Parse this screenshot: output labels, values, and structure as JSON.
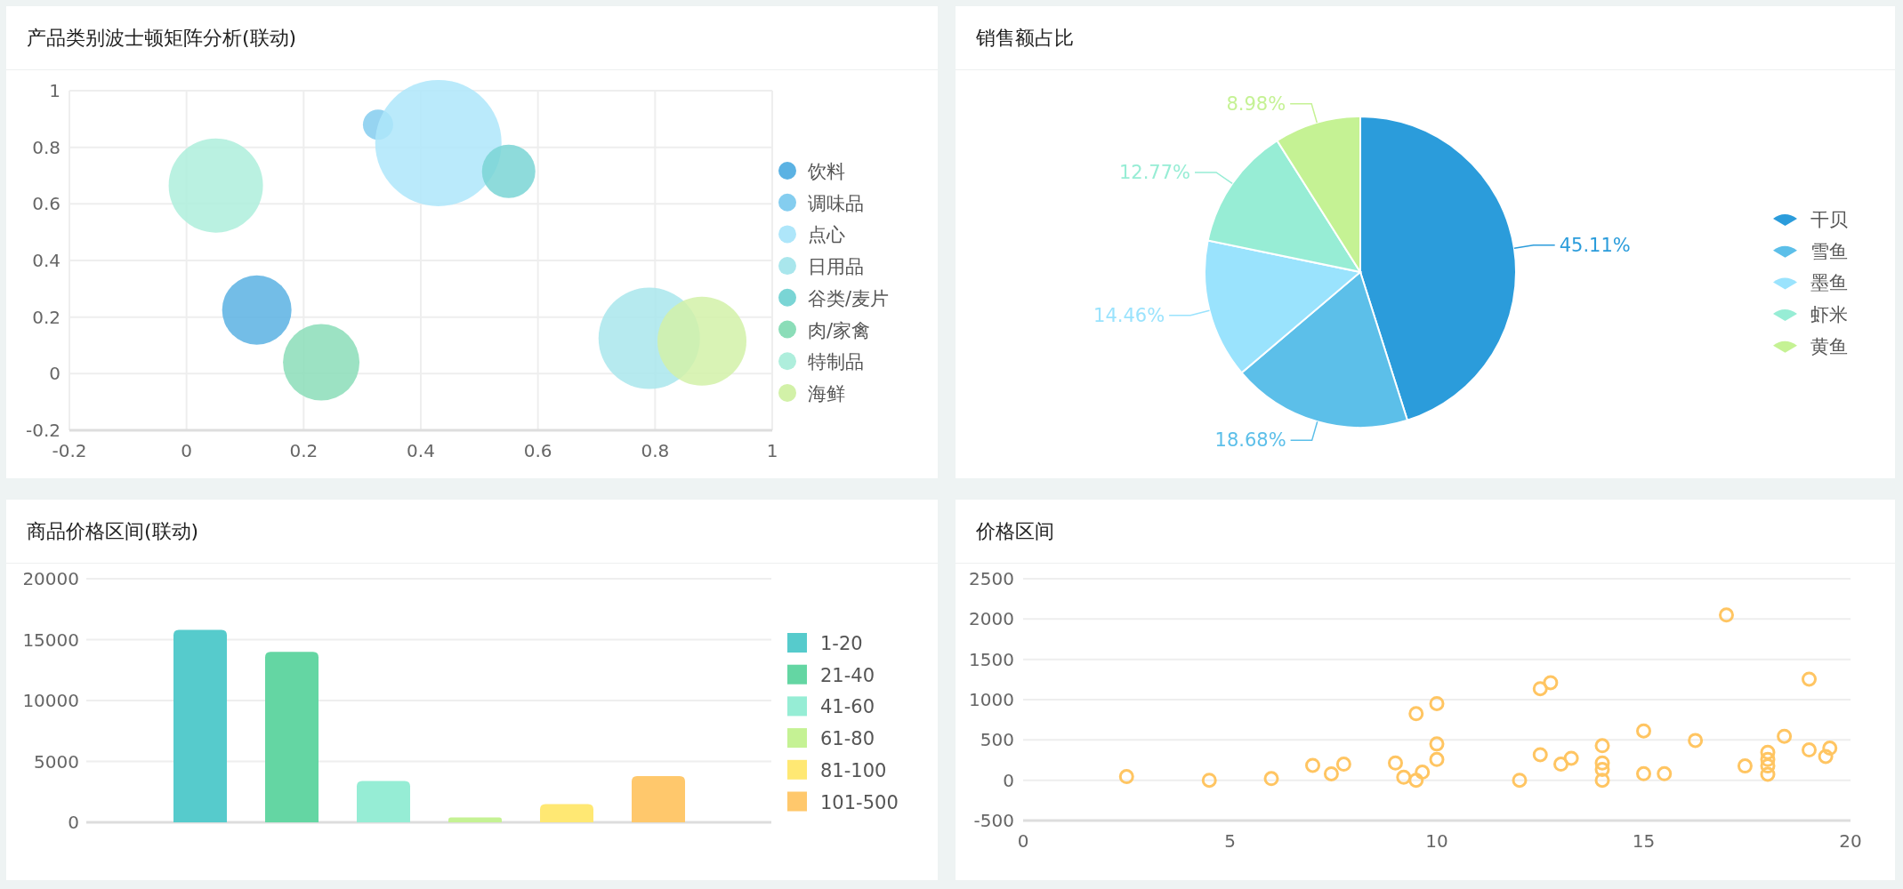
{
  "panels": [
    {
      "title": "产品类别波士顿矩阵分析(联动)",
      "chart_data": {
        "type": "scatter",
        "xlim": [
          -0.2,
          1
        ],
        "ylim": [
          -0.2,
          1
        ],
        "xticks": [
          -0.2,
          0,
          0.2,
          0.4,
          0.6,
          0.8,
          1
        ],
        "yticks": [
          -0.2,
          0,
          0.2,
          0.4,
          0.6,
          0.8,
          1
        ],
        "grid": true,
        "legend": "right",
        "x": [
          0.12,
          0.327,
          0.43,
          0.79,
          0.55,
          0.23,
          0.05,
          0.88
        ],
        "series": [
          {
            "name": "饮料",
            "color": "#5bb2e3",
            "values": [
              0.225,
              null,
              null,
              null,
              null,
              null,
              null,
              null
            ]
          },
          {
            "name": "调味品",
            "color": "#84cdef",
            "values": [
              null,
              0.88,
              null,
              null,
              null,
              null,
              null,
              null
            ]
          },
          {
            "name": "点心",
            "color": "#aee6fa",
            "values": [
              null,
              null,
              0.815,
              null,
              null,
              null,
              null,
              null
            ]
          },
          {
            "name": "日用品",
            "color": "#a9e6ec",
            "values": [
              null,
              null,
              null,
              0.125,
              null,
              null,
              null,
              null
            ]
          },
          {
            "name": "谷类/麦片",
            "color": "#7ad5d5",
            "values": [
              null,
              null,
              null,
              null,
              0.715,
              null,
              null,
              null
            ]
          },
          {
            "name": "肉/家禽",
            "color": "#8bddb8",
            "values": [
              null,
              null,
              null,
              null,
              null,
              0.04,
              null,
              null
            ]
          },
          {
            "name": "特制品",
            "color": "#aeeedc",
            "values": [
              null,
              null,
              null,
              null,
              null,
              null,
              0.665,
              null
            ]
          },
          {
            "name": "海鲜",
            "color": "#d2f1a8",
            "values": [
              null,
              null,
              null,
              null,
              null,
              null,
              null,
              0.115
            ]
          }
        ]
      }
    },
    {
      "title": "销售额占比",
      "chart_data": {
        "type": "pie",
        "legend": "right",
        "categories": [
          "干贝",
          "雪鱼",
          "墨鱼",
          "虾米",
          "黄鱼"
        ],
        "values": [
          45.11,
          18.68,
          14.46,
          12.77,
          8.98
        ],
        "value_labels": [
          "45.11%",
          "18.68%",
          "14.46%",
          "12.77%",
          "8.98%"
        ],
        "colors": [
          "#2b9cdb",
          "#5cbfe9",
          "#9ae3fd",
          "#97edd5",
          "#c5f294"
        ]
      }
    },
    {
      "title": "商品价格区间(联动)",
      "chart_data": {
        "type": "bar",
        "grid": true,
        "legend": "right",
        "ylim": [
          0,
          20000
        ],
        "yticks": [
          0,
          5000,
          10000,
          15000,
          20000
        ],
        "series": [
          {
            "name": "1-20",
            "color": "#56cbcc",
            "values": [
              15800
            ]
          },
          {
            "name": "21-40",
            "color": "#64d6a3",
            "values": [
              14000
            ]
          },
          {
            "name": "41-60",
            "color": "#96edd5",
            "values": [
              3400
            ]
          },
          {
            "name": "61-80",
            "color": "#c5f294",
            "values": [
              400
            ]
          },
          {
            "name": "81-100",
            "color": "#ffe873",
            "values": [
              1500
            ]
          },
          {
            "name": "101-500",
            "color": "#ffc86c",
            "values": [
              3800
            ]
          }
        ]
      }
    },
    {
      "title": "价格区间",
      "chart_data": {
        "type": "scatter",
        "grid": true,
        "xlim": [
          0,
          20
        ],
        "ylim": [
          -500,
          2500
        ],
        "xticks": [
          0,
          5,
          10,
          15,
          20
        ],
        "yticks": [
          -500,
          0,
          500,
          1000,
          1500,
          2000,
          2500
        ],
        "x": [
          2.5,
          4.5,
          6,
          7,
          7.45,
          7.75,
          9,
          9.2,
          9.5,
          9.5,
          9.65,
          10,
          10,
          10,
          12,
          12.5,
          12.5,
          12.75,
          13,
          13.25,
          14,
          14,
          14,
          14,
          15,
          15,
          15.5,
          16.25,
          17,
          17.45,
          18,
          18,
          18,
          18,
          18.4,
          19,
          19,
          19.4,
          19.5
        ],
        "series": [
          {
            "color": "#ffc562",
            "values": [
              45,
              0,
              20,
              184,
              80,
              200,
              214,
              37,
              826,
              0,
              100,
              951,
              450,
              258,
              0,
              1136,
              317,
              1210,
              200,
              273,
              428,
              214,
              133,
              0,
              612,
              81,
              81,
              494,
              2050,
              177,
              347,
              258,
              177,
              74,
              546,
              1254,
              376,
              295,
              398
            ]
          }
        ]
      }
    }
  ]
}
